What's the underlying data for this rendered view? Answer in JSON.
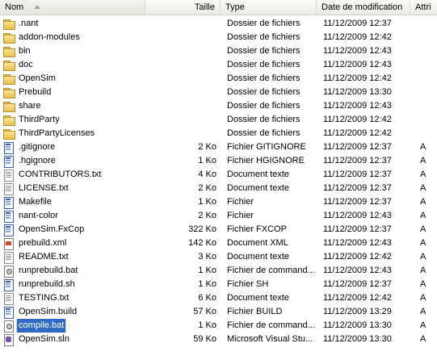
{
  "columns": {
    "name": "Nom",
    "size": "Taille",
    "type": "Type",
    "date": "Date de modification",
    "attr": "Attri"
  },
  "rows": [
    {
      "name": ".nant",
      "icon": "folder-icon",
      "size": "",
      "type": "Dossier de fichiers",
      "date": "11/12/2009 12:37",
      "attr": ""
    },
    {
      "name": "addon-modules",
      "icon": "folder-icon",
      "size": "",
      "type": "Dossier de fichiers",
      "date": "11/12/2009 12:42",
      "attr": ""
    },
    {
      "name": "bin",
      "icon": "folder-icon",
      "size": "",
      "type": "Dossier de fichiers",
      "date": "11/12/2009 12:43",
      "attr": ""
    },
    {
      "name": "doc",
      "icon": "folder-icon",
      "size": "",
      "type": "Dossier de fichiers",
      "date": "11/12/2009 12:43",
      "attr": ""
    },
    {
      "name": "OpenSim",
      "icon": "folder-icon",
      "size": "",
      "type": "Dossier de fichiers",
      "date": "11/12/2009 12:42",
      "attr": ""
    },
    {
      "name": "Prebuild",
      "icon": "folder-icon",
      "size": "",
      "type": "Dossier de fichiers",
      "date": "11/12/2009 13:30",
      "attr": ""
    },
    {
      "name": "share",
      "icon": "folder-icon",
      "size": "",
      "type": "Dossier de fichiers",
      "date": "11/12/2009 12:43",
      "attr": ""
    },
    {
      "name": "ThirdParty",
      "icon": "folder-icon",
      "size": "",
      "type": "Dossier de fichiers",
      "date": "11/12/2009 12:42",
      "attr": ""
    },
    {
      "name": "ThirdPartyLicenses",
      "icon": "folder-icon",
      "size": "",
      "type": "Dossier de fichiers",
      "date": "11/12/2009 12:42",
      "attr": ""
    },
    {
      "name": ".gitignore",
      "icon": "generic-file-icon",
      "size": "2 Ko",
      "type": "Fichier GITIGNORE",
      "date": "11/12/2009 12:37",
      "attr": "A"
    },
    {
      "name": ".hgignore",
      "icon": "generic-file-icon",
      "size": "1 Ko",
      "type": "Fichier HGIGNORE",
      "date": "11/12/2009 12:37",
      "attr": "A"
    },
    {
      "name": "CONTRIBUTORS.txt",
      "icon": "text-file-icon",
      "size": "4 Ko",
      "type": "Document texte",
      "date": "11/12/2009 12:37",
      "attr": "A"
    },
    {
      "name": "LICENSE.txt",
      "icon": "text-file-icon",
      "size": "2 Ko",
      "type": "Document texte",
      "date": "11/12/2009 12:37",
      "attr": "A"
    },
    {
      "name": "Makefile",
      "icon": "generic-file-icon",
      "size": "1 Ko",
      "type": "Fichier",
      "date": "11/12/2009 12:37",
      "attr": "A"
    },
    {
      "name": "nant-color",
      "icon": "generic-file-icon",
      "size": "2 Ko",
      "type": "Fichier",
      "date": "11/12/2009 12:43",
      "attr": "A"
    },
    {
      "name": "OpenSim.FxCop",
      "icon": "generic-file-icon",
      "size": "322 Ko",
      "type": "Fichier FXCOP",
      "date": "11/12/2009 12:37",
      "attr": "A"
    },
    {
      "name": "prebuild.xml",
      "icon": "xml-file-icon",
      "size": "142 Ko",
      "type": "Document XML",
      "date": "11/12/2009 12:43",
      "attr": "A"
    },
    {
      "name": "README.txt",
      "icon": "text-file-icon",
      "size": "3 Ko",
      "type": "Document texte",
      "date": "11/12/2009 12:42",
      "attr": "A"
    },
    {
      "name": "runprebuild.bat",
      "icon": "batch-file-icon",
      "size": "1 Ko",
      "type": "Fichier de command...",
      "date": "11/12/2009 12:43",
      "attr": "A"
    },
    {
      "name": "runprebuild.sh",
      "icon": "generic-file-icon",
      "size": "1 Ko",
      "type": "Fichier SH",
      "date": "11/12/2009 12:37",
      "attr": "A"
    },
    {
      "name": "TESTING.txt",
      "icon": "text-file-icon",
      "size": "6 Ko",
      "type": "Document texte",
      "date": "11/12/2009 12:42",
      "attr": "A"
    },
    {
      "name": "OpenSim.build",
      "icon": "generic-file-icon",
      "size": "57 Ko",
      "type": "Fichier BUILD",
      "date": "11/12/2009 13:29",
      "attr": "A"
    },
    {
      "name": "compile.bat",
      "icon": "batch-file-icon",
      "size": "1 Ko",
      "type": "Fichier de command...",
      "date": "11/12/2009 13:30",
      "attr": "A",
      "selected": true
    },
    {
      "name": "OpenSim.sln",
      "icon": "solution-file-icon",
      "size": "59 Ko",
      "type": "Microsoft Visual Stu...",
      "date": "11/12/2009 13:30",
      "attr": "A"
    }
  ]
}
